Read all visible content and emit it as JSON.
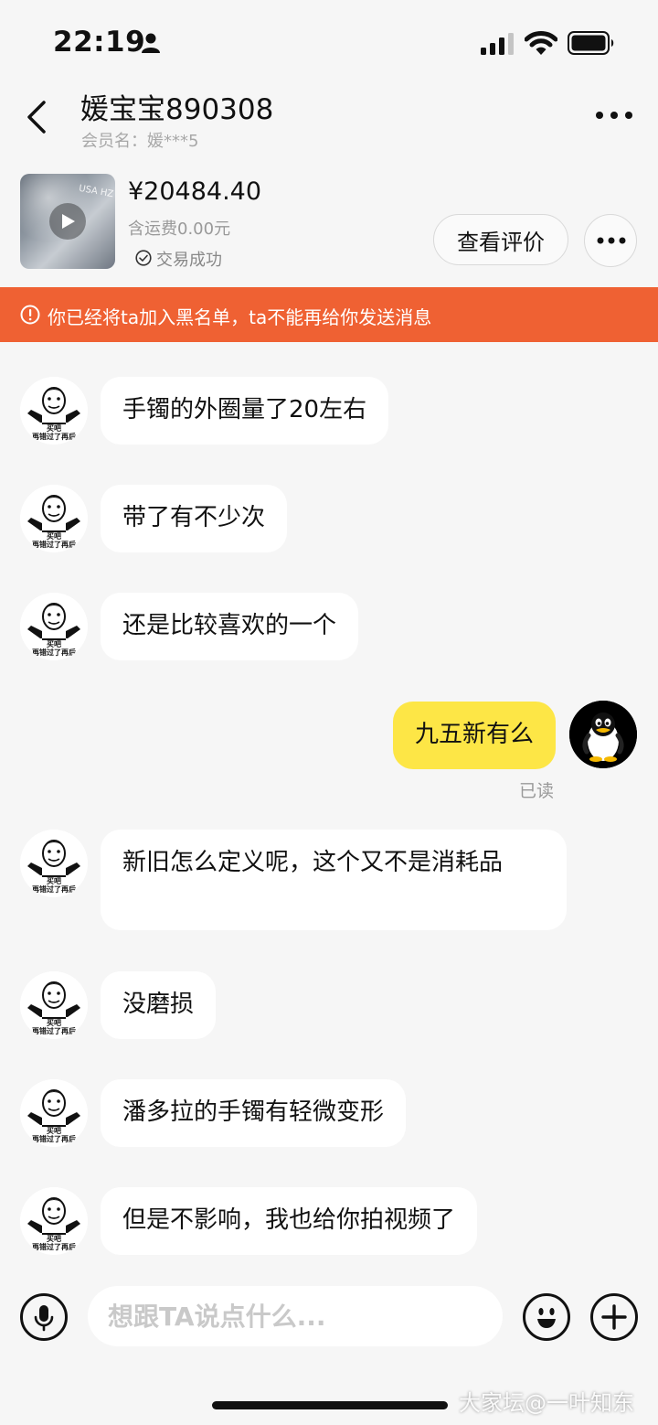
{
  "status_bar": {
    "time": "22:19"
  },
  "header": {
    "title": "媛宝宝890308",
    "member": "会员名：媛***5"
  },
  "order": {
    "price": "¥20484.40",
    "shipping": "含运费0.00元",
    "status": "交易成功",
    "review_label": "查看评价",
    "thumb_text": "USA HZ"
  },
  "banner": {
    "text": "你已经将ta加入黑名单，ta不能再给你发送消息"
  },
  "avatar_caption": {
    "line1": "买吧",
    "line2": "再错过了再后"
  },
  "messages": [
    {
      "side": "other",
      "text": "手镯的外圈量了20左右"
    },
    {
      "side": "other",
      "text": "带了有不少次"
    },
    {
      "side": "other",
      "text": "还是比较喜欢的一个"
    },
    {
      "side": "me",
      "text": "九五新有么",
      "read": "已读"
    },
    {
      "side": "other",
      "text": "新旧怎么定义呢，这个又不是消耗品"
    },
    {
      "side": "other",
      "text": "没磨损"
    },
    {
      "side": "other",
      "text": "潘多拉的手镯有轻微变形"
    },
    {
      "side": "other",
      "text": "但是不影响，我也给你拍视频了"
    }
  ],
  "input": {
    "placeholder": "想跟TA说点什么..."
  },
  "watermark": "大家坛@一叶知东",
  "colors": {
    "banner": "#ef6133",
    "my_bubble": "#fde646",
    "background": "#f6f6f6"
  }
}
